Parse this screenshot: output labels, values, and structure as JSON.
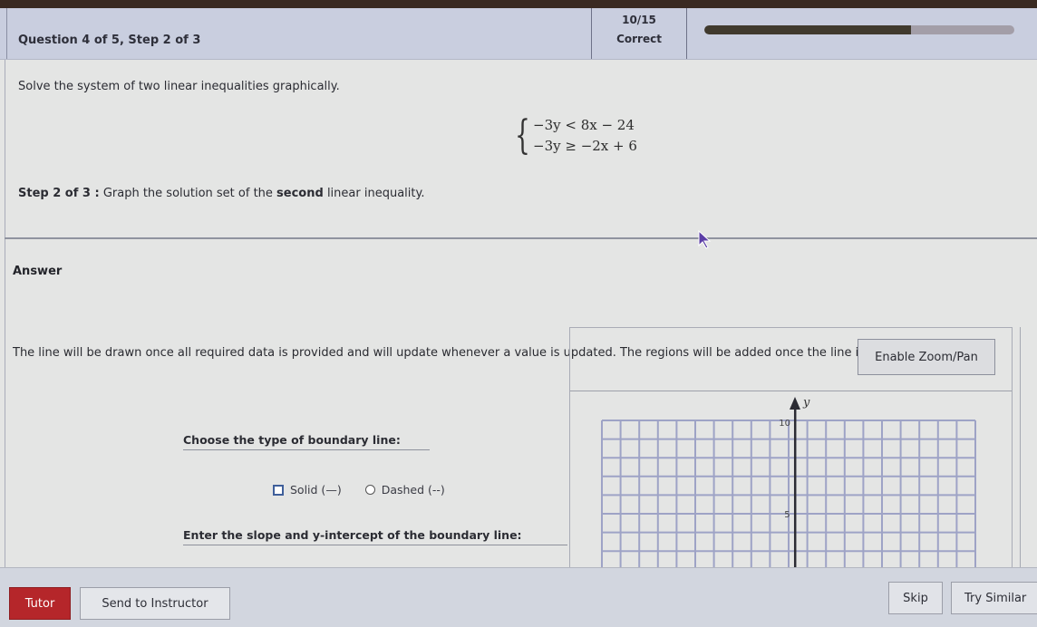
{
  "header": {
    "question_title": "Question 4 of 5, Step 2 of 3",
    "score": "10/15",
    "score_label": "Correct",
    "progress_fraction": 0.667
  },
  "problem": {
    "instruction": "Solve the system of two linear inequalities graphically.",
    "inequalities": [
      "−3y < 8x − 24",
      "−3y ≥ −2x + 6"
    ],
    "step_prefix": "Step 2 of 3 :",
    "step_text_before": " Graph the solution set of the ",
    "step_bold": "second",
    "step_text_after": " linear inequality."
  },
  "answer": {
    "heading": "Answer",
    "note": "The line will be drawn once all required data is provided and will update whenever a value is updated. The regions will be added once the line is drawn",
    "boundary_label": "Choose the type of boundary line:",
    "options": [
      {
        "label": "Solid (—)",
        "selected": false
      },
      {
        "label": "Dashed (--)",
        "selected": false
      }
    ],
    "slope_label": "Enter the slope and y-intercept of the boundary line:"
  },
  "graph": {
    "zoom_button": "Enable Zoom/Pan",
    "axis_label_y": "y",
    "y_tick_labels": [
      "10",
      "5"
    ],
    "icons": {
      "axis_arrow": "arrow-up-icon"
    }
  },
  "footer": {
    "tutor": "Tutor",
    "send": "Send to Instructor",
    "skip": "Skip",
    "try_similar": "Try Similar"
  },
  "colors": {
    "tutor_bg": "#b5262a",
    "radio_square": "#3f5f9a",
    "grid_line": "#9ea3c6"
  }
}
